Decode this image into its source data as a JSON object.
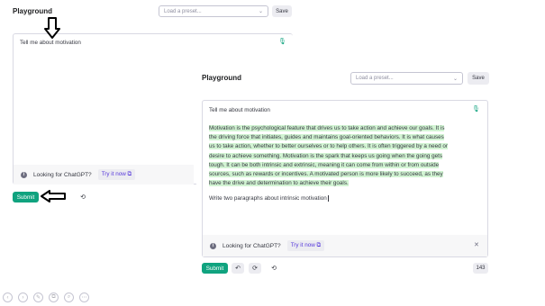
{
  "background_window": {
    "title": "Playground",
    "preset_placeholder": "Load a preset...",
    "save_label": "Save",
    "prompt_text": "Tell me about motivation",
    "banner_text": "Looking for ChatGPT?",
    "try_label": "Try it now",
    "submit_label": "Submit"
  },
  "front_window": {
    "title": "Playground",
    "preset_placeholder": "Load a preset...",
    "save_label": "Save",
    "prompt_text": "Tell me about motivation",
    "completion_lines": [
      "Motivation is the psychological feature that drives us to take action and achieve our goals. It is",
      "the driving force that initiates, guides and maintains goal-oriented behaviors. It is what causes",
      "us to take action, whether to better ourselves or to help others. It is often triggered by a need or",
      "desire to achieve something. Motivation is the spark that keeps us going when the going gets",
      "tough. It can be both intrinsic and extrinsic, meaning it can come from within or from outside",
      "sources, such as rewards or incentives. A motivated person is more likely to succeed, as they",
      "have the drive and determination to achieve their goals."
    ],
    "followup_text": "Write two paragraphs about intrinsic motivation",
    "banner_text": "Looking for ChatGPT?",
    "try_label": "Try it now",
    "submit_label": "Submit",
    "token_count": "143"
  },
  "icons": {
    "mic": "mic-icon",
    "external": "external-link-icon",
    "close": "close-icon",
    "undo": "undo-icon",
    "regenerate": "regenerate-icon",
    "history": "history-icon",
    "arrow_down": "arrow-down-annotation",
    "arrow_left": "arrow-left-annotation"
  },
  "colors": {
    "accent": "#10a37f",
    "highlight": "#d2f4d3",
    "link": "#5436da"
  }
}
